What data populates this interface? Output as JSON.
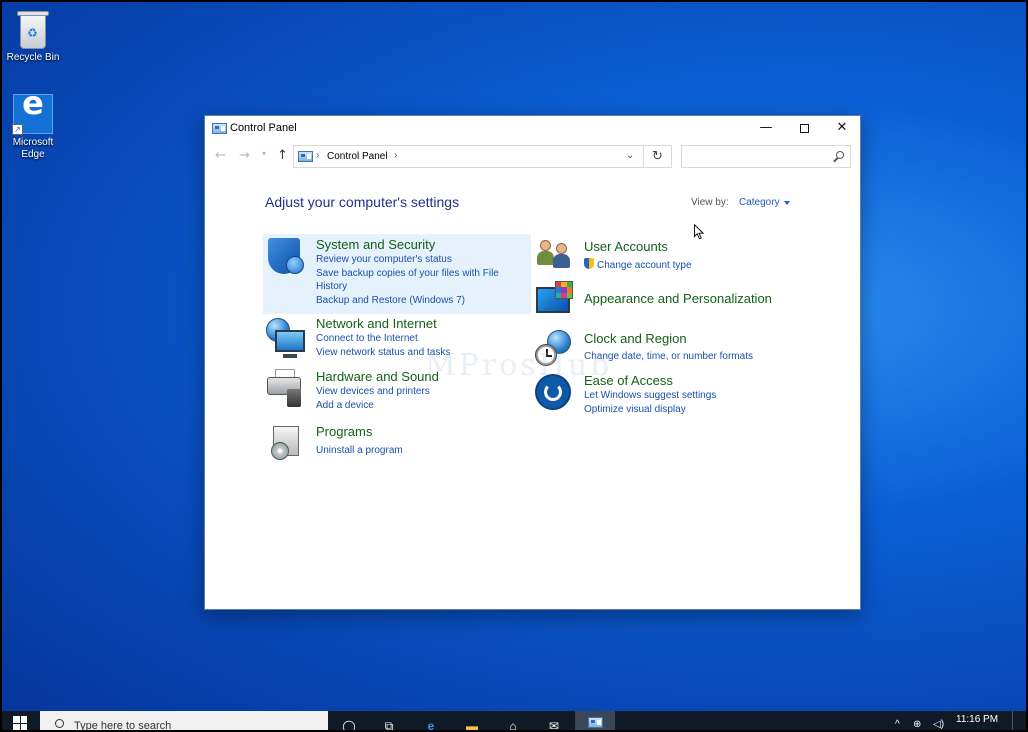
{
  "desktop": {
    "icons": [
      {
        "label": "Recycle Bin"
      },
      {
        "label": "Microsoft Edge"
      }
    ]
  },
  "window": {
    "title": "Control Panel",
    "address": {
      "path_label": "Control Panel"
    },
    "heading": "Adjust your computer's settings",
    "view_by_label": "View by:",
    "view_by_value": "Category",
    "categories": [
      {
        "title": "System and Security",
        "links": [
          "Review your computer's status",
          "Save backup copies of your files with File",
          "History",
          "Backup and Restore (Windows 7)"
        ]
      },
      {
        "title": "Network and Internet",
        "links": [
          "Connect to the Internet",
          "View network status and tasks"
        ]
      },
      {
        "title": "Hardware and Sound",
        "links": [
          "View devices and printers",
          "Add a device"
        ]
      },
      {
        "title": "Programs",
        "links": [
          "Uninstall a program"
        ]
      },
      {
        "title": "User Accounts",
        "links": [
          "Change account type"
        ]
      },
      {
        "title": "Appearance and Personalization",
        "links": []
      },
      {
        "title": "Clock and Region",
        "links": [
          "Change date, time, or number formats"
        ]
      },
      {
        "title": "Ease of Access",
        "links": [
          "Let Windows suggest settings",
          "Optimize visual display"
        ]
      }
    ],
    "watermark": "MProsHub"
  },
  "taskbar": {
    "search_placeholder": "Type here to search",
    "time": "11:16 PM"
  },
  "colors": {
    "category_title": "#136116",
    "link": "#1a52a8",
    "heading": "#1e3287",
    "highlight": "#e5f1fb",
    "taskbar": "#101a26"
  }
}
